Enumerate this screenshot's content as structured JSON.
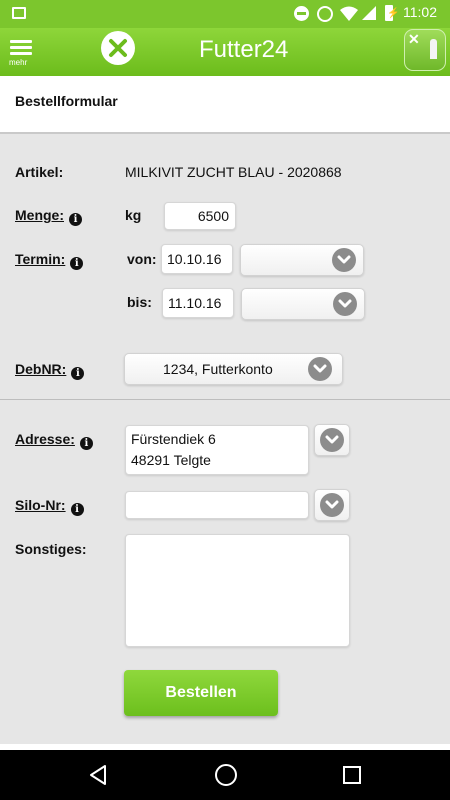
{
  "status_bar": {
    "time": "11:02"
  },
  "app_bar": {
    "menu_label": "mehr",
    "title": "Futter24"
  },
  "form": {
    "header": "Bestellformular",
    "article": {
      "label": "Artikel:",
      "value": "MILKIVIT ZUCHT BLAU - 2020868"
    },
    "quantity": {
      "label": "Menge:",
      "unit": "kg",
      "value": "6500"
    },
    "date": {
      "label": "Termin:",
      "from_label": "von:",
      "from_value": "10.10.16",
      "to_label": "bis:",
      "to_value": "11.10.16"
    },
    "debnr": {
      "label": "DebNR:",
      "value": "1234, Futterkonto"
    },
    "address": {
      "label": "Adresse:",
      "line1": "Fürstendiek 6",
      "line2": "48291 Telgte"
    },
    "silo": {
      "label": "Silo-Nr:",
      "value": ""
    },
    "other": {
      "label": "Sonstiges:",
      "value": ""
    },
    "submit_label": "Bestellen"
  },
  "colors": {
    "primary_green": "#7cc62d",
    "nav_bar": "#000000"
  }
}
